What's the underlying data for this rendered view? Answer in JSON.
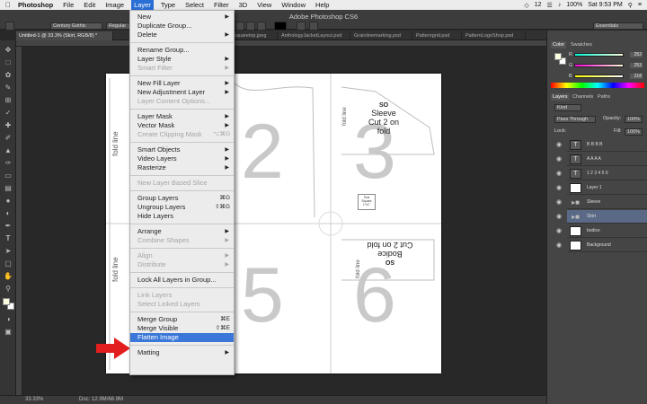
{
  "app": {
    "title": "Adobe Photoshop CS6"
  },
  "mac_menu": {
    "app_name": "Photoshop",
    "items": [
      "File",
      "Edit",
      "Image",
      "Layer",
      "Type",
      "Select",
      "Filter",
      "3D",
      "View",
      "Window",
      "Help"
    ],
    "active": "Layer",
    "clock": "Sat 9:53 PM",
    "battery": "100%",
    "badge": "12"
  },
  "options": {
    "font_family": "Century Gothic",
    "font_style": "Regular",
    "workspace": "Essentials"
  },
  "tabs": [
    "Untitled-1 @ 33.3% (Skirt, RGB/8) *",
    "squaretop.jpeg",
    "AnthologyJacketLayout.psd",
    "Grainlinemarking.psd",
    "Patterngrid.psd",
    "PatternLogoShop.psd"
  ],
  "status": {
    "zoom": "33.33%",
    "doc": "Doc: 12.9M/68.9M"
  },
  "canvas": {
    "numbers": [
      "2",
      "3",
      "5",
      "6"
    ],
    "fold_line": "fold line",
    "sleeve": "Sleeve",
    "sleeve_sub": "Cut 2 on fold",
    "bodice": "Bodice",
    "bodice_sub": "Cut 2 on fold",
    "logo": "SO",
    "test_square": "Test Square 1\"x1\""
  },
  "layer_menu": {
    "items": [
      {
        "label": "New",
        "arrow": true
      },
      {
        "label": "Duplicate Group...",
        "arrow": false
      },
      {
        "label": "Delete",
        "arrow": true
      },
      {
        "sep": true
      },
      {
        "label": "Rename Group...",
        "arrow": false
      },
      {
        "label": "Layer Style",
        "arrow": true
      },
      {
        "label": "Smart Filter",
        "arrow": true,
        "disabled": true
      },
      {
        "sep": true
      },
      {
        "label": "New Fill Layer",
        "arrow": true
      },
      {
        "label": "New Adjustment Layer",
        "arrow": true
      },
      {
        "label": "Layer Content Options...",
        "disabled": true
      },
      {
        "sep": true
      },
      {
        "label": "Layer Mask",
        "arrow": true
      },
      {
        "label": "Vector Mask",
        "arrow": true
      },
      {
        "label": "Create Clipping Mask",
        "shortcut": "⌥⌘G",
        "disabled": true
      },
      {
        "sep": true
      },
      {
        "label": "Smart Objects",
        "arrow": true
      },
      {
        "label": "Video Layers",
        "arrow": true
      },
      {
        "label": "Rasterize",
        "arrow": true
      },
      {
        "sep": true
      },
      {
        "label": "New Layer Based Slice",
        "disabled": true
      },
      {
        "sep": true
      },
      {
        "label": "Group Layers",
        "shortcut": "⌘G"
      },
      {
        "label": "Ungroup Layers",
        "shortcut": "⇧⌘G"
      },
      {
        "label": "Hide Layers"
      },
      {
        "sep": true
      },
      {
        "label": "Arrange",
        "arrow": true
      },
      {
        "label": "Combine Shapes",
        "arrow": true,
        "disabled": true
      },
      {
        "sep": true
      },
      {
        "label": "Align",
        "arrow": true,
        "disabled": true
      },
      {
        "label": "Distribute",
        "arrow": true,
        "disabled": true
      },
      {
        "sep": true
      },
      {
        "label": "Lock All Layers in Group..."
      },
      {
        "sep": true
      },
      {
        "label": "Link Layers",
        "disabled": true
      },
      {
        "label": "Select Linked Layers",
        "disabled": true
      },
      {
        "sep": true
      },
      {
        "label": "Merge Group",
        "shortcut": "⌘E"
      },
      {
        "label": "Merge Visible",
        "shortcut": "⇧⌘E"
      },
      {
        "label": "Flatten Image",
        "highlight": true
      },
      {
        "sep": true
      },
      {
        "label": "Matting",
        "arrow": true
      }
    ]
  },
  "panels": {
    "color_tabs": [
      "Color",
      "Swatches"
    ],
    "color": {
      "R": "252",
      "G": "253",
      "B": "218"
    },
    "layers_tabs": [
      "Layers",
      "Channels",
      "Paths"
    ],
    "kind": "Kind",
    "blend": "Pass Through",
    "opacity_label": "Opacity:",
    "opacity": "100%",
    "lock_label": "Lock:",
    "fill_label": "Fill:",
    "fill": "100%",
    "layers": [
      {
        "name": "B B B B",
        "type": "text"
      },
      {
        "name": "A A A A",
        "type": "text"
      },
      {
        "name": "1 2 3 4 5 6",
        "type": "text"
      },
      {
        "name": "Layer 1",
        "type": "pixel"
      },
      {
        "name": "Sleeve",
        "type": "group"
      },
      {
        "name": "Skirt",
        "type": "group",
        "selected": true
      },
      {
        "name": "bodice",
        "type": "pixel"
      },
      {
        "name": "Background",
        "type": "pixel"
      }
    ]
  }
}
